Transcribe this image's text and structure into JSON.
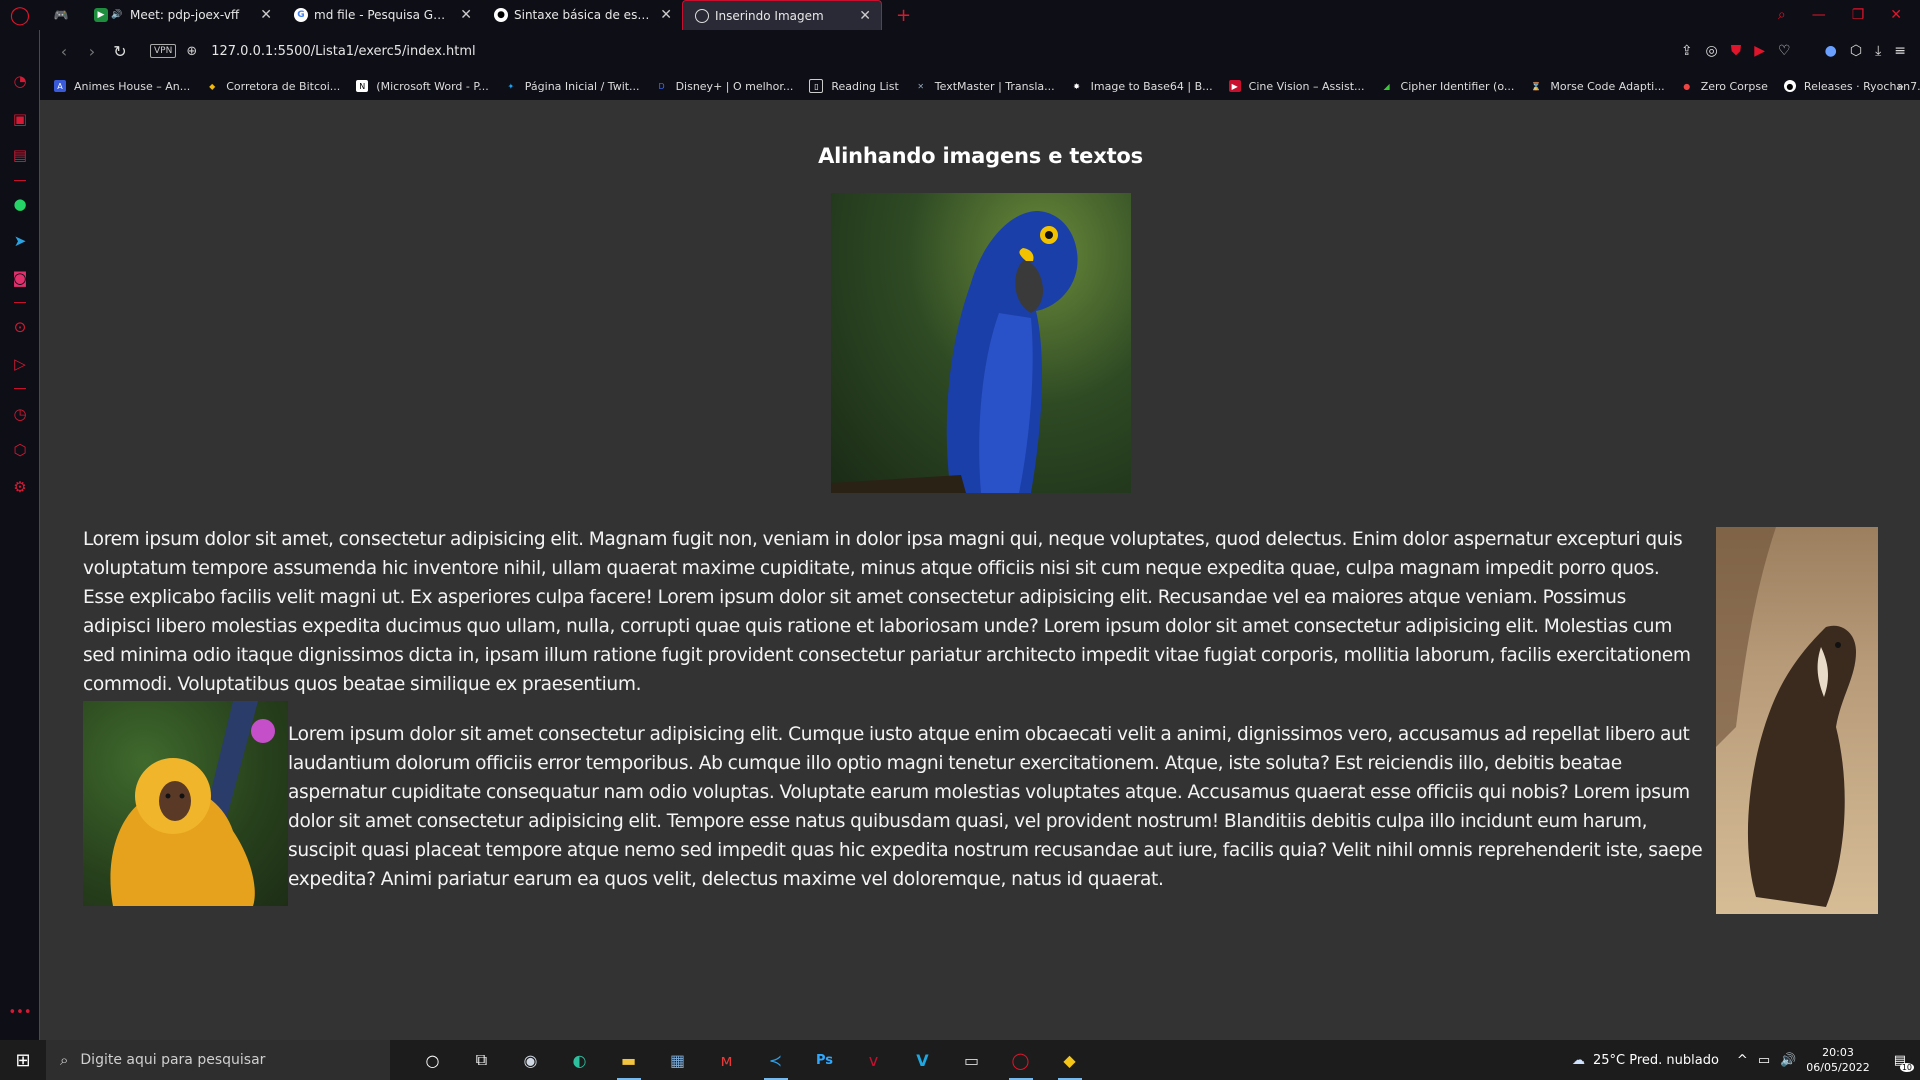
{
  "browser": {
    "tabs": [
      {
        "title": "Meet: pdp-joex-vff",
        "favicon": "meet-icon"
      },
      {
        "title": "md file - Pesquisa Google",
        "favicon": "google-icon"
      },
      {
        "title": "Sintaxe básica de escrita e f",
        "favicon": "github-icon"
      },
      {
        "title": "Inserindo Imagem",
        "favicon": "globe-icon",
        "active": true
      }
    ],
    "url": "127.0.0.1:5500/Lista1/exerc5/index.html",
    "vpn_label": "VPN",
    "bookmarks": [
      "Animes House – An...",
      "Corretora de Bitcoi...",
      "(Microsoft Word - P...",
      "Página Inicial / Twit...",
      "Disney+ | O melhor...",
      "Reading List",
      "TextMaster | Transla...",
      "Image to Base64 | B...",
      "Cine Vision – Assist...",
      "Cipher Identifier (o...",
      "Morse Code Adapti...",
      "Zero Corpse",
      "Releases · Ryochan7..."
    ],
    "accent_color": "#c8102e"
  },
  "page": {
    "heading": "Alinhando imagens e textos",
    "paragraph1": "Lorem ipsum dolor sit amet, consectetur adipisicing elit. Magnam fugit non, veniam in dolor ipsa magni qui, neque voluptates, quod delectus. Enim dolor aspernatur excepturi quis voluptatum tempore assumenda hic inventore nihil, ullam quaerat maxime cupiditate, minus atque officiis nisi sit cum neque expedita quae, culpa magnam impedit porro quos. Esse explicabo facilis velit magni ut. Ex asperiores culpa facere! Lorem ipsum dolor sit amet consectetur adipisicing elit. Recusandae vel ea maiores atque veniam. Possimus adipisci libero molestias expedita ducimus quo ullam, nulla, corrupti quae quis ratione et laboriosam unde? Lorem ipsum dolor sit amet consectetur adipisicing elit. Molestias cum sed minima odio itaque dignissimos dicta in, ipsam illum ratione fugit provident consectetur pariatur architecto impedit vitae fugiat corporis, mollitia laborum, facilis exercitationem commodi. Voluptatibus quos beatae similique ex praesentium.",
    "paragraph2": "Lorem ipsum dolor sit amet consectetur adipisicing elit. Cumque iusto atque enim obcaecati velit a animi, dignissimos vero, accusamus ad repellat libero aut laudantium dolorum officiis error temporibus. Ab cumque illo optio magni tenetur exercitationem. Atque, iste soluta? Est reiciendis illo, debitis beatae aspernatur cupiditate consequatur nam odio voluptas. Voluptate earum molestias voluptates atque. Accusamus quaerat esse officiis qui nobis? Lorem ipsum dolor sit amet consectetur adipisicing elit. Tempore esse natus quibusdam quasi, vel provident nostrum! Blanditiis debitis culpa illo incidunt eum harum, suscipit quasi placeat tempore atque nemo sed impedit quas hic expedita nostrum recusandae aut iure, facilis quia? Velit nihil omnis reprehenderit iste, saepe expedita? Animi pariatur earum ea quos velit, delectus maxime vel doloremque, natus id quaerat.",
    "background_color": "#333333"
  },
  "taskbar": {
    "search_placeholder": "Digite aqui para pesquisar",
    "weather": "25°C  Pred. nublado",
    "time": "20:03",
    "date": "06/05/2022",
    "notification_count": "10"
  }
}
